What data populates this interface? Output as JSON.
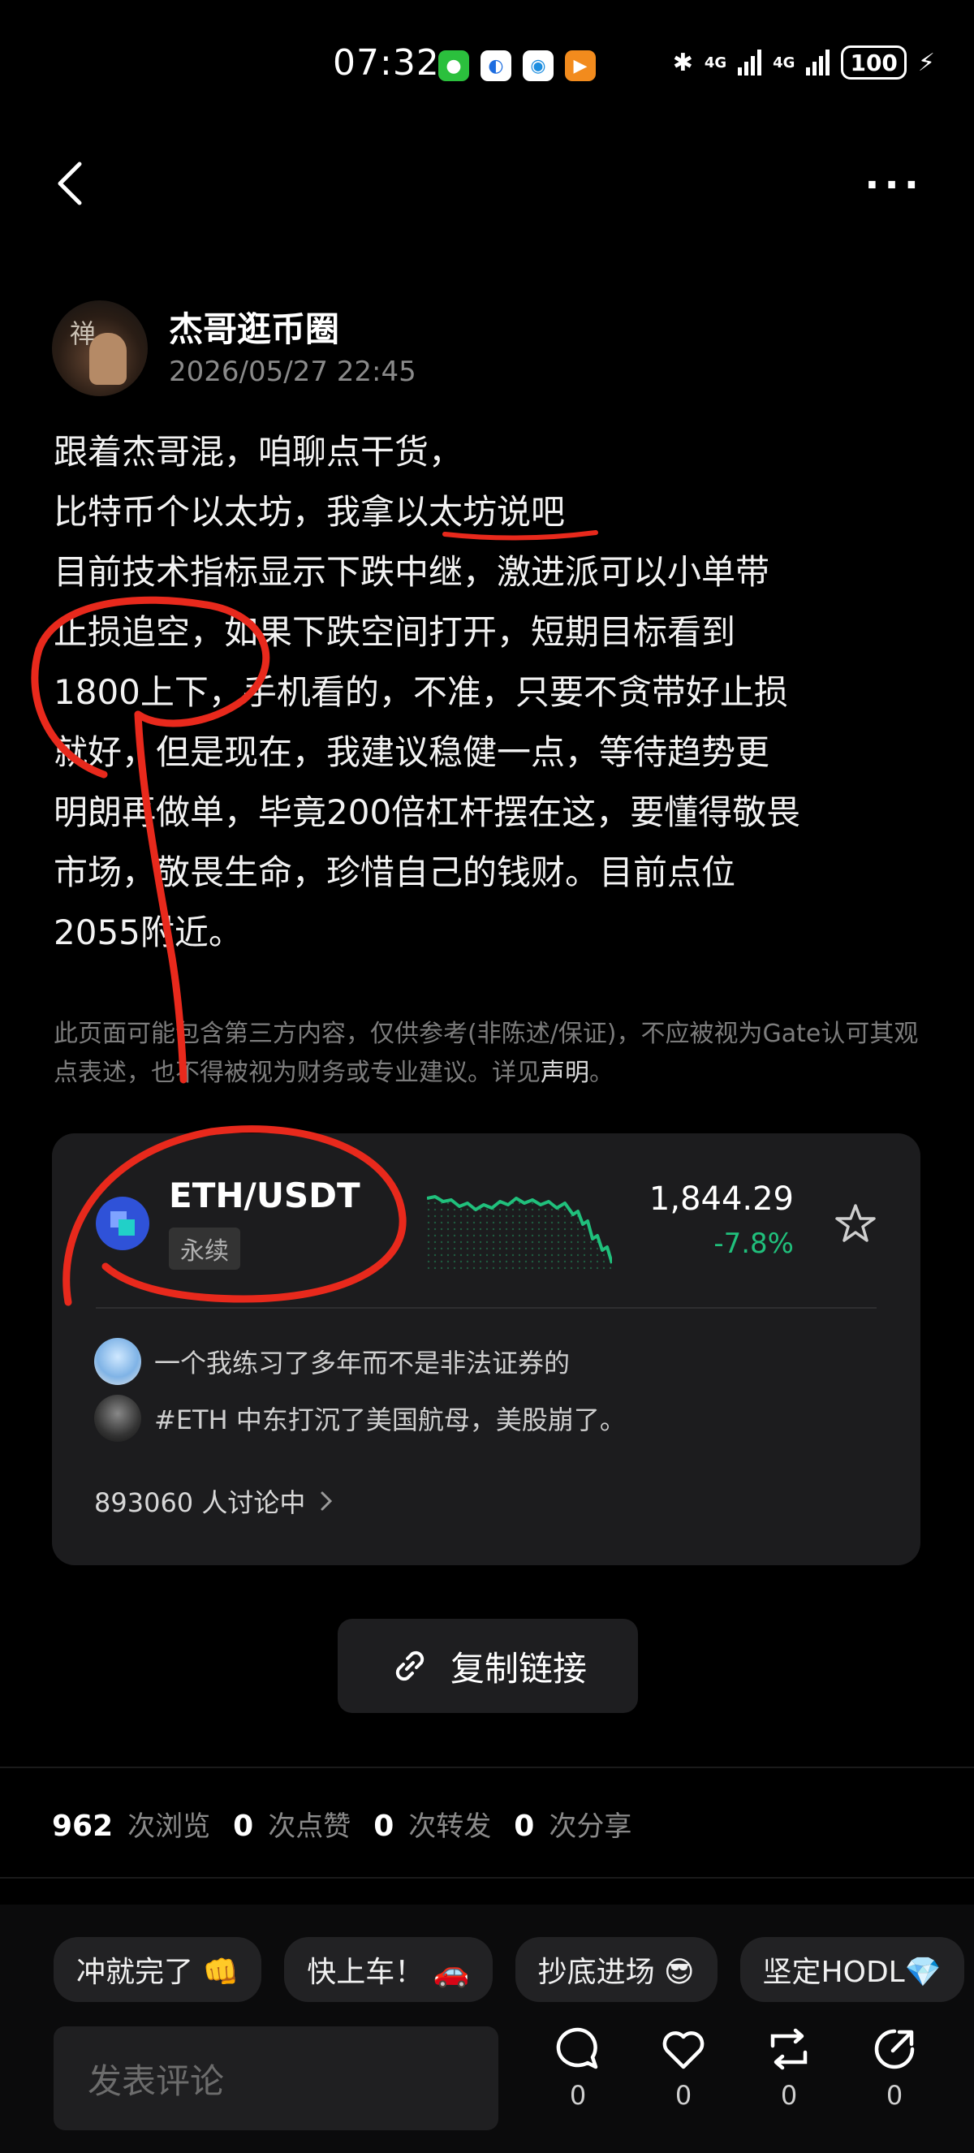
{
  "status_bar": {
    "time": "07:32",
    "net1": "4G",
    "net2": "4G",
    "battery": "100"
  },
  "author": {
    "name": "杰哥逛币圈",
    "timestamp": "2026/05/27 22:45",
    "avatar_seal": "禅"
  },
  "post": {
    "lines": [
      "跟着杰哥混，咱聊点干货，",
      "比特币个以太坊，我拿以太坊说吧",
      "目前技术指标显示下跌中继，激进派可以小单带",
      "止损追空，如果下跌空间打开，短期目标看到",
      "1800上下，手机看的，不准，只要不贪带好止损",
      "就好，但是现在，我建议稳健一点，等待趋势更",
      "明朗再做单，毕竟200倍杠杆摆在这，要懂得敬畏",
      "市场，敬畏生命，珍惜自己的钱财。目前点位",
      "2055附近。"
    ],
    "disclaimer_text": "此页面可能包含第三方内容，仅供参考(非陈述/保证)，不应被视为Gate认可其观点表述，也不得被视为财务或专业建议。详见",
    "disclaimer_link": "声明",
    "disclaimer_end": "。"
  },
  "market_card": {
    "pair": "ETH/USDT",
    "tag": "永续",
    "price": "1,844.29",
    "change": "-7.8%",
    "discussions": [
      "一个我练习了多年而不是非法证券的",
      "#ETH 中东打沉了美国航母，美股崩了。"
    ],
    "discussing_count": "893060 人讨论中",
    "colors": {
      "up": "#20c07c"
    }
  },
  "copy_link": {
    "label": "复制链接"
  },
  "stats": {
    "views": "962",
    "views_label": "次浏览",
    "likes": "0",
    "likes_label": "次点赞",
    "reposts": "0",
    "reposts_label": "次转发",
    "shares": "0",
    "shares_label": "次分享"
  },
  "quick_replies": [
    "冲就完了 👊",
    "快上车！ 🚗",
    "抄底进场 😎",
    "坚定HODL💎"
  ],
  "comment": {
    "placeholder": "发表评论",
    "actions": {
      "comment_count": "0",
      "like_count": "0",
      "repost_count": "0",
      "share_count": "0"
    }
  }
}
